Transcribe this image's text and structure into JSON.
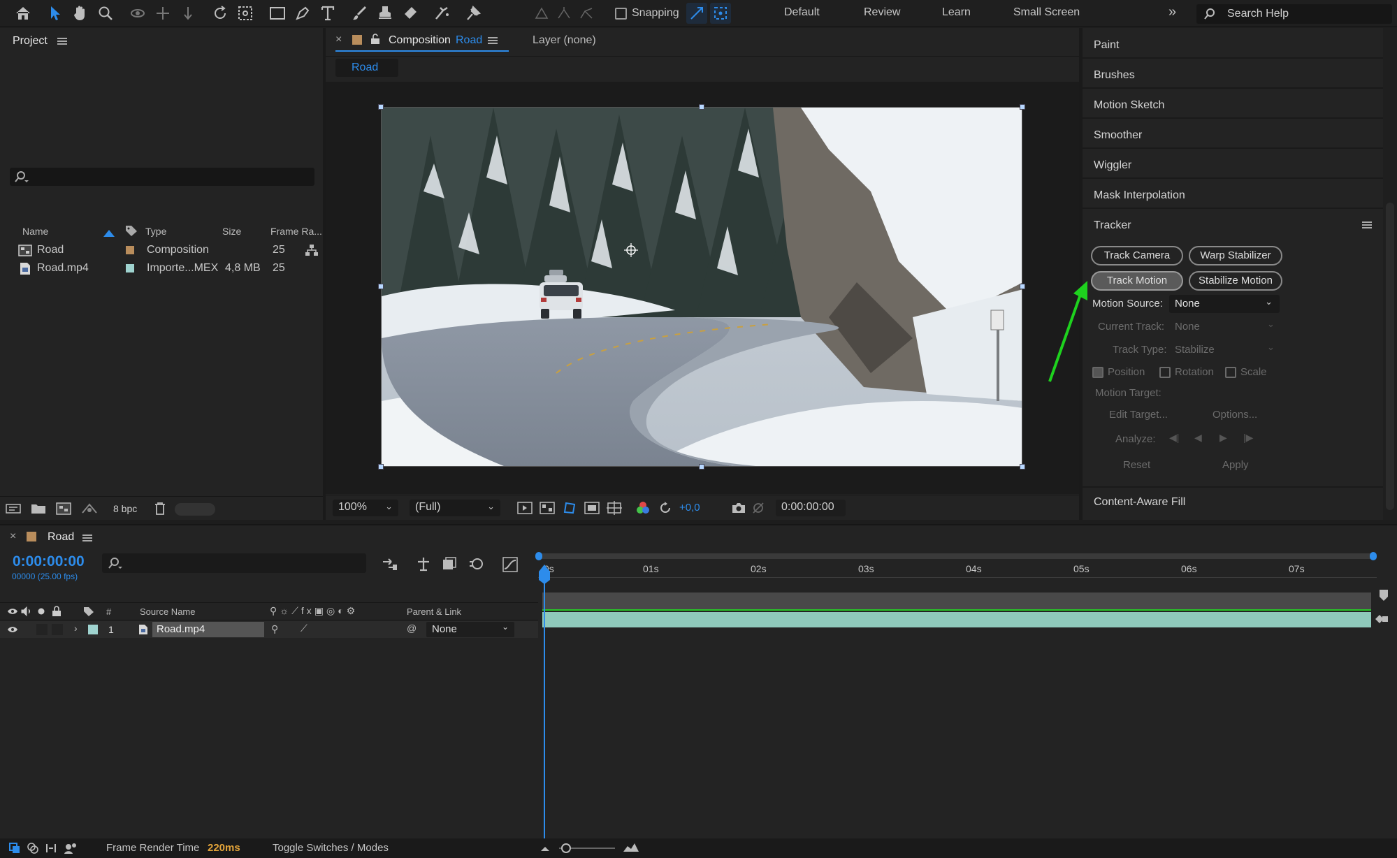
{
  "toolbar": {
    "snapping_label": "Snapping",
    "workspaces": [
      "Default",
      "Review",
      "Learn",
      "Small Screen"
    ],
    "search_placeholder": "Search Help"
  },
  "project": {
    "title": "Project",
    "columns": {
      "name": "Name",
      "type": "Type",
      "size": "Size",
      "frame_rate": "Frame Ra..."
    },
    "items": [
      {
        "name": "Road",
        "type": "Composition",
        "size": "",
        "frame_rate": "25",
        "label_color": "#b98d5c"
      },
      {
        "name": "Road.mp4",
        "type": "Importe...MEX",
        "size": "4,8 MB",
        "frame_rate": "25",
        "label_color": "#9fd3cf"
      }
    ],
    "bpc_label": "8 bpc"
  },
  "composition": {
    "tab_prefix": "Composition",
    "tab_name": "Road",
    "layer_tab": "Layer (none)",
    "breadcrumb": "Road",
    "zoom": "100%",
    "resolution": "(Full)",
    "exposure": "+0,0",
    "timecode": "0:00:00:00"
  },
  "right_panel": {
    "rows": [
      "Paint",
      "Brushes",
      "Motion Sketch",
      "Smoother",
      "Wiggler",
      "Mask Interpolation"
    ],
    "tracker": {
      "title": "Tracker",
      "track_camera": "Track Camera",
      "warp_stabilizer": "Warp Stabilizer",
      "track_motion": "Track Motion",
      "stabilize_motion": "Stabilize Motion",
      "motion_source_label": "Motion Source:",
      "motion_source_value": "None",
      "current_track_label": "Current Track:",
      "current_track_value": "None",
      "track_type_label": "Track Type:",
      "track_type_value": "Stabilize",
      "position": "Position",
      "rotation": "Rotation",
      "scale": "Scale",
      "motion_target": "Motion Target:",
      "edit_target": "Edit Target...",
      "options": "Options...",
      "analyze": "Analyze:",
      "reset": "Reset",
      "apply": "Apply"
    },
    "content_aware_fill": "Content-Aware Fill"
  },
  "timeline": {
    "comp_name": "Road",
    "timecode": "0:00:00:00",
    "frame_info": "00000 (25.00 fps)",
    "col_source_name": "Source Name",
    "col_parent": "Parent & Link",
    "col_hash": "#",
    "ticks": [
      "0s",
      "01s",
      "02s",
      "03s",
      "04s",
      "05s",
      "06s",
      "07s"
    ],
    "layer": {
      "index": "1",
      "name": "Road.mp4",
      "parent": "None",
      "label_color": "#9fd3cf"
    }
  },
  "status": {
    "frame_render_label": "Frame Render Time",
    "frame_render_value": "220ms",
    "toggle_label": "Toggle Switches / Modes"
  },
  "colors": {
    "accent_blue": "#2d8ceb",
    "track_green": "#8fc9bb",
    "arrow_green": "#1ed21e"
  }
}
